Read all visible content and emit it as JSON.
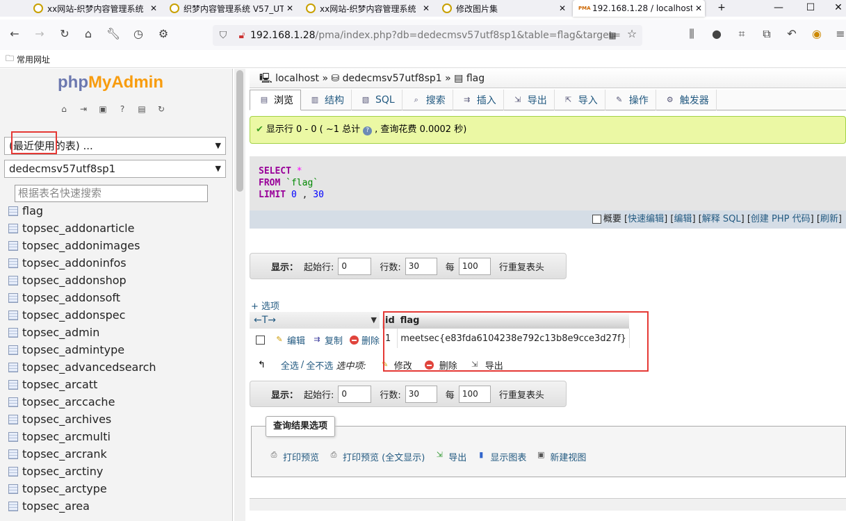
{
  "browser": {
    "tabs": [
      {
        "title": "xx网站-织梦内容管理系统"
      },
      {
        "title": "织梦内容管理系统 V57_UT"
      },
      {
        "title": "xx网站-织梦内容管理系统"
      },
      {
        "title": "修改图片集"
      },
      {
        "title": "192.168.1.28 / localhost"
      }
    ],
    "new_tab": "+",
    "url_host": "192.168.1.28",
    "url_rest": "/pma/index.php?db=dedecmsv57utf8sp1&table=flag&target=",
    "bookmark": "常用网址"
  },
  "sidebar": {
    "logo_php": "php",
    "logo_myadmin": "MyAdmin",
    "recent_select": "(最近使用的表) ...",
    "db_select": "dedecmsv57utf8sp1",
    "search_placeholder": "根据表名快速搜索",
    "tables": [
      "flag",
      "topsec_addonarticle",
      "topsec_addonimages",
      "topsec_addoninfos",
      "topsec_addonshop",
      "topsec_addonsoft",
      "topsec_addonspec",
      "topsec_admin",
      "topsec_admintype",
      "topsec_advancedsearch",
      "topsec_arcatt",
      "topsec_arccache",
      "topsec_archives",
      "topsec_arcmulti",
      "topsec_arcrank",
      "topsec_arctiny",
      "topsec_arctype",
      "topsec_area"
    ]
  },
  "breadcrumb": {
    "server": "localhost",
    "db": "dedecmsv57utf8sp1",
    "table": "flag",
    "sep": "»"
  },
  "menu": [
    "浏览",
    "结构",
    "SQL",
    "搜索",
    "插入",
    "导出",
    "导入",
    "操作",
    "触发器"
  ],
  "success": {
    "text1": "显示行 0 - 0 ( ~1 总计",
    "text2": ", 查询花费 0.0002 秒)"
  },
  "sql": {
    "select": "SELECT",
    "star": "*",
    "from": "FROM",
    "table": "`flag`",
    "limit": "LIMIT",
    "n1": "0",
    "comma": ",",
    "n2": "30"
  },
  "sql_options": {
    "profile": "概要",
    "inline_edit": "快速编辑",
    "edit": "编辑",
    "explain": "解释 SQL",
    "php": "创建 PHP 代码",
    "refresh": "刷新"
  },
  "nav": {
    "show": "显示：",
    "start_label": "起始行:",
    "start": "0",
    "rows_label": "行数:",
    "rows": "30",
    "per_label": "每",
    "per": "100",
    "repeat_label": "行重复表头"
  },
  "options_link": "+ 选项",
  "arrows": "←T→",
  "row_actions": {
    "edit": "编辑",
    "copy": "复制",
    "delete": "删除"
  },
  "result": {
    "headers": [
      "id",
      "flag"
    ],
    "rows": [
      [
        "1",
        "meetsec{e83fda6104238e792c13b8e9cce3d27f}"
      ]
    ]
  },
  "selection": {
    "check_all": "全选",
    "sep": "/",
    "uncheck_all": "全不选",
    "with_selected": "选中项:",
    "change": "修改",
    "delete": "删除",
    "export": "导出"
  },
  "query_results": {
    "legend": "查询结果选项",
    "print": "打印预览",
    "print_full": "打印预览 (全文显示)",
    "export": "导出",
    "chart": "显示图表",
    "view": "新建视图"
  }
}
